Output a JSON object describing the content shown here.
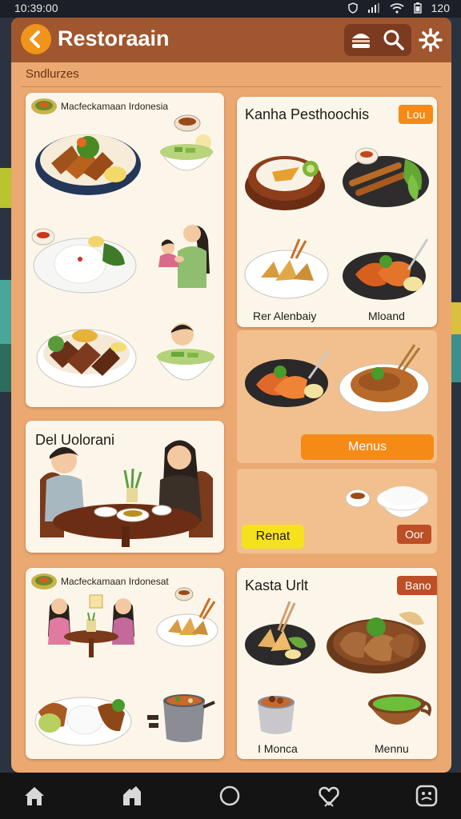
{
  "status_bar": {
    "time": "10:39:00",
    "battery": "120"
  },
  "app": {
    "title": "Restoraain",
    "section_title": "Sndlurzes"
  },
  "cards": {
    "card1": {
      "label": "Macfeckamaan Irdonesia"
    },
    "card2": {
      "title": "Kanha Pesthoochis",
      "badge": "Lou",
      "caption_left": "Rer Alenbaiy",
      "caption_right": "Mloand"
    },
    "card3": {
      "button": "Menus"
    },
    "card4": {
      "title": "Del   Uolorani"
    },
    "card5": {
      "yellow_button": "Renat",
      "small_button": "Oor"
    },
    "card6": {
      "label": "Macfeckamaan Irdonesat"
    },
    "card7": {
      "title": "Kasta Urlt",
      "badge": "Bano",
      "caption_left": "I Monca",
      "caption_right": "Mennu"
    }
  },
  "colors": {
    "app_background": "#eba870",
    "app_bar": "#a0562e",
    "accent_orange": "#f58b16",
    "accent_yellow": "#f6e21c",
    "badge_dark_orange": "#bd4e26"
  },
  "icons": {
    "back": "chevron-left-icon",
    "burger": "burger-icon",
    "search": "search-icon",
    "settings": "gear-icon",
    "nav": [
      "home-icon",
      "store-icon",
      "circle-icon",
      "heart-icon",
      "profile-icon"
    ]
  }
}
